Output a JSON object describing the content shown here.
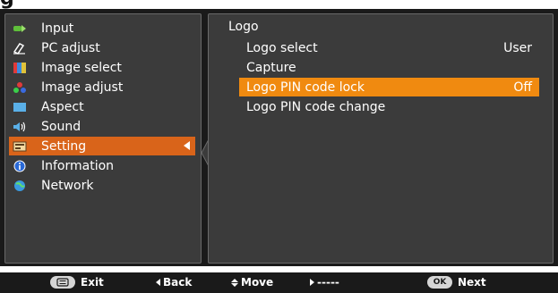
{
  "heading": "g",
  "menu": {
    "items": [
      {
        "label": "Input",
        "icon": "input-icon"
      },
      {
        "label": "PC adjust",
        "icon": "pc-adjust-icon"
      },
      {
        "label": "Image select",
        "icon": "image-select-icon"
      },
      {
        "label": "Image adjust",
        "icon": "image-adjust-icon"
      },
      {
        "label": "Aspect",
        "icon": "aspect-icon"
      },
      {
        "label": "Sound",
        "icon": "sound-icon"
      },
      {
        "label": "Setting",
        "icon": "setting-icon",
        "selected": true
      },
      {
        "label": "Information",
        "icon": "information-icon"
      },
      {
        "label": "Network",
        "icon": "network-icon"
      }
    ]
  },
  "submenu": {
    "title": "Logo",
    "items": [
      {
        "label": "Logo select",
        "value": "User"
      },
      {
        "label": "Capture",
        "value": ""
      },
      {
        "label": "Logo PIN code lock",
        "value": "Off",
        "selected": true
      },
      {
        "label": "Logo PIN code change",
        "value": ""
      }
    ]
  },
  "footer": {
    "menu_key": "MENU",
    "exit": "Exit",
    "back": "Back",
    "move": "Move",
    "right_action": "-----",
    "ok_key": "OK",
    "next": "Next"
  },
  "colors": {
    "selected_main": "#d9641a",
    "selected_sub": "#f08a10",
    "panel_bg": "#3b3b3b"
  }
}
